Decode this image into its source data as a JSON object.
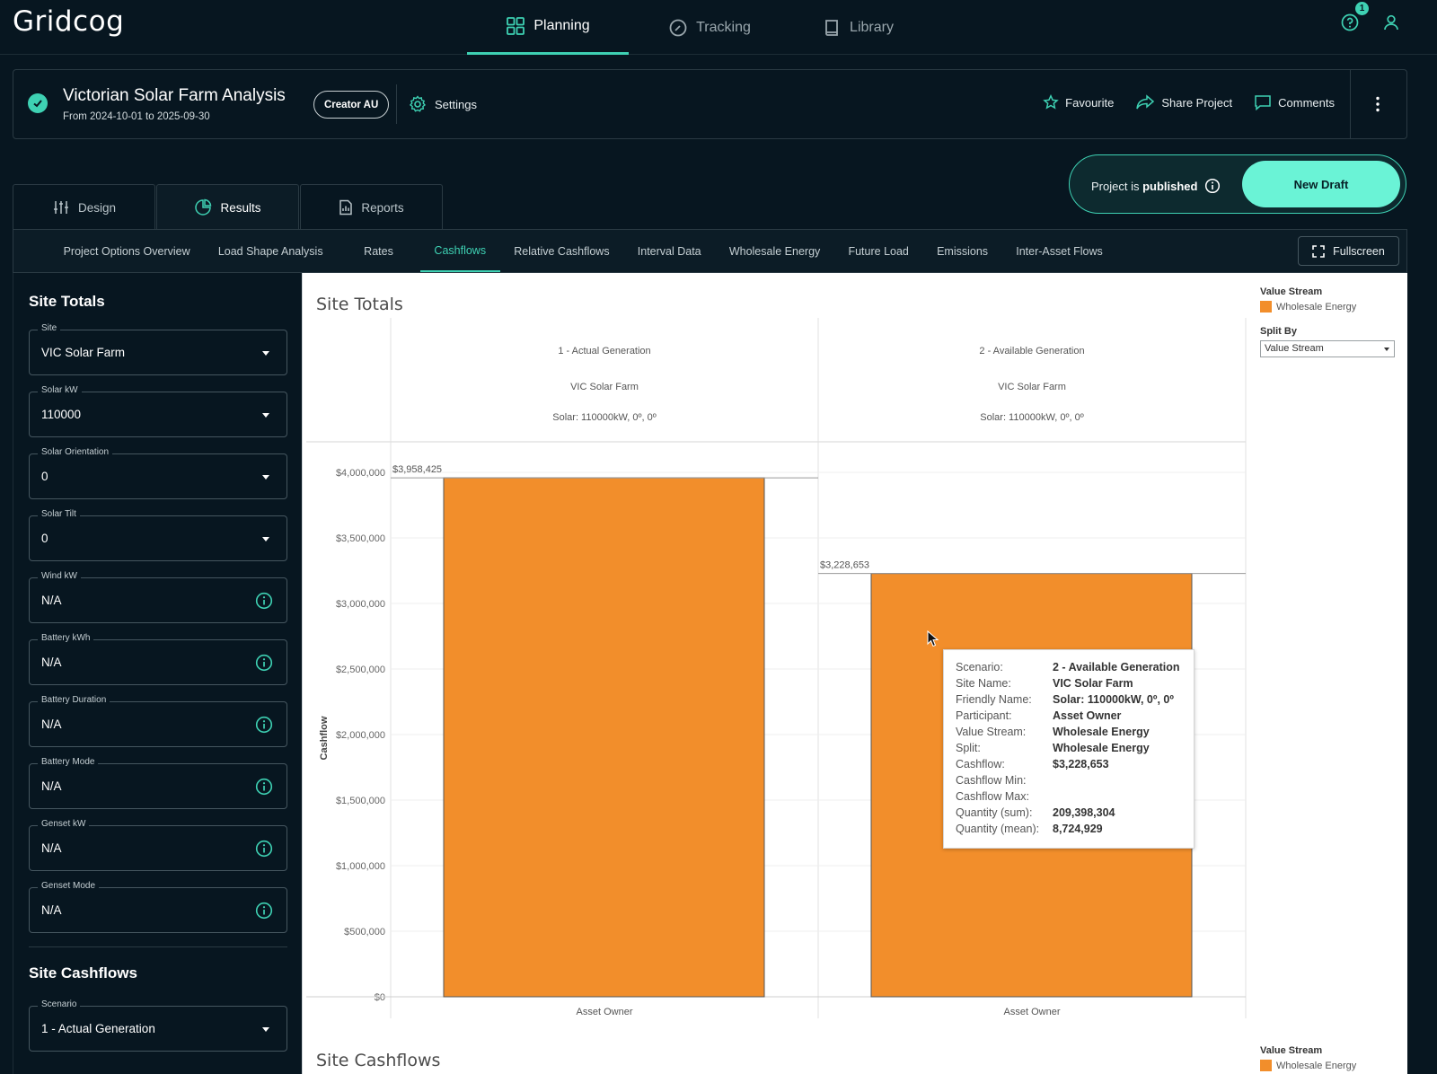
{
  "app": {
    "logo": "Gridcog",
    "nav": [
      {
        "label": "Planning",
        "icon": "grid-icon",
        "active": true
      },
      {
        "label": "Tracking",
        "icon": "gauge-icon",
        "active": false
      },
      {
        "label": "Library",
        "icon": "book-icon",
        "active": false
      }
    ],
    "notification_count": "1"
  },
  "project": {
    "title": "Victorian Solar Farm Analysis",
    "date_range": "From 2024-10-01 to 2025-09-30",
    "badge": "Creator AU",
    "settings_label": "Settings",
    "favourite_label": "Favourite",
    "share_label": "Share Project",
    "comments_label": "Comments",
    "status_prefix": "Project is",
    "status_word": "published",
    "new_draft_label": "New Draft"
  },
  "tabs": [
    {
      "label": "Design",
      "icon": "sliders-icon"
    },
    {
      "label": "Results",
      "icon": "pie-chart-icon"
    },
    {
      "label": "Reports",
      "icon": "report-icon"
    }
  ],
  "subtabs": [
    "Project Options Overview",
    "Load Shape Analysis",
    "Rates",
    "Cashflows",
    "Relative Cashflows",
    "Interval Data",
    "Wholesale Energy",
    "Future Load",
    "Emissions",
    "Inter-Asset Flows"
  ],
  "active_subtab": "Cashflows",
  "fullscreen_label": "Fullscreen",
  "left_panel": {
    "heading": "Site Totals",
    "fields": [
      {
        "label": "Site",
        "value": "VIC Solar Farm",
        "kind": "select"
      },
      {
        "label": "Solar kW",
        "value": "110000",
        "kind": "select"
      },
      {
        "label": "Solar Orientation",
        "value": "0",
        "kind": "select"
      },
      {
        "label": "Solar Tilt",
        "value": "0",
        "kind": "select"
      },
      {
        "label": "Wind kW",
        "value": "N/A",
        "kind": "info"
      },
      {
        "label": "Battery kWh",
        "value": "N/A",
        "kind": "info"
      },
      {
        "label": "Battery Duration",
        "value": "N/A",
        "kind": "info"
      },
      {
        "label": "Battery Mode",
        "value": "N/A",
        "kind": "info"
      },
      {
        "label": "Genset kW",
        "value": "N/A",
        "kind": "info"
      },
      {
        "label": "Genset Mode",
        "value": "N/A",
        "kind": "info"
      }
    ],
    "heading2": "Site Cashflows",
    "scenario_field": {
      "label": "Scenario",
      "value": "1 - Actual Generation"
    }
  },
  "chart_legend": {
    "title": "Value Stream",
    "entry": "Wholesale Energy",
    "color": "#f28e2b",
    "split_by_label": "Split By",
    "split_by_value": "Value Stream"
  },
  "chart_data": {
    "type": "bar",
    "title": "Site Totals",
    "ylabel": "Cashflow",
    "ylim": [
      0,
      4000000
    ],
    "yticks": [
      "$0",
      "$500,000",
      "$1,000,000",
      "$1,500,000",
      "$2,000,000",
      "$2,500,000",
      "$3,000,000",
      "$3,500,000",
      "$4,000,000"
    ],
    "ytick_values": [
      0,
      500000,
      1000000,
      1500000,
      2000000,
      2500000,
      3000000,
      3500000,
      4000000
    ],
    "panels": [
      {
        "scenario": "1 - Actual Generation",
        "site": "VIC Solar Farm",
        "friendly": "Solar: 110000kW, 0º, 0º",
        "category": "Asset Owner",
        "value": 3958425,
        "label": "$3,958,425"
      },
      {
        "scenario": "2 - Available Generation",
        "site": "VIC Solar Farm",
        "friendly": "Solar: 110000kW, 0º, 0º",
        "category": "Asset Owner",
        "value": 3228653,
        "label": "$3,228,653"
      }
    ],
    "bar_color": "#f28e2b"
  },
  "tooltip": [
    {
      "k": "Scenario:",
      "v": "2 - Available Generation"
    },
    {
      "k": "Site Name:",
      "v": "VIC Solar Farm"
    },
    {
      "k": "Friendly Name:",
      "v": "Solar: 110000kW, 0º, 0º"
    },
    {
      "k": "Participant:",
      "v": "Asset Owner"
    },
    {
      "k": "Value Stream:",
      "v": "Wholesale Energy"
    },
    {
      "k": "Split:",
      "v": "Wholesale Energy"
    },
    {
      "k": "Cashflow:",
      "v": "$3,228,653"
    },
    {
      "k": "Cashflow Min:",
      "v": ""
    },
    {
      "k": "Cashflow Max:",
      "v": ""
    },
    {
      "k": "Quantity (sum):",
      "v": "209,398,304"
    },
    {
      "k": "Quantity (mean):",
      "v": "8,724,929"
    }
  ],
  "second_chart": {
    "title": "Site Cashflows",
    "legend_title": "Value Stream",
    "legend_entry": "Wholesale Energy"
  }
}
